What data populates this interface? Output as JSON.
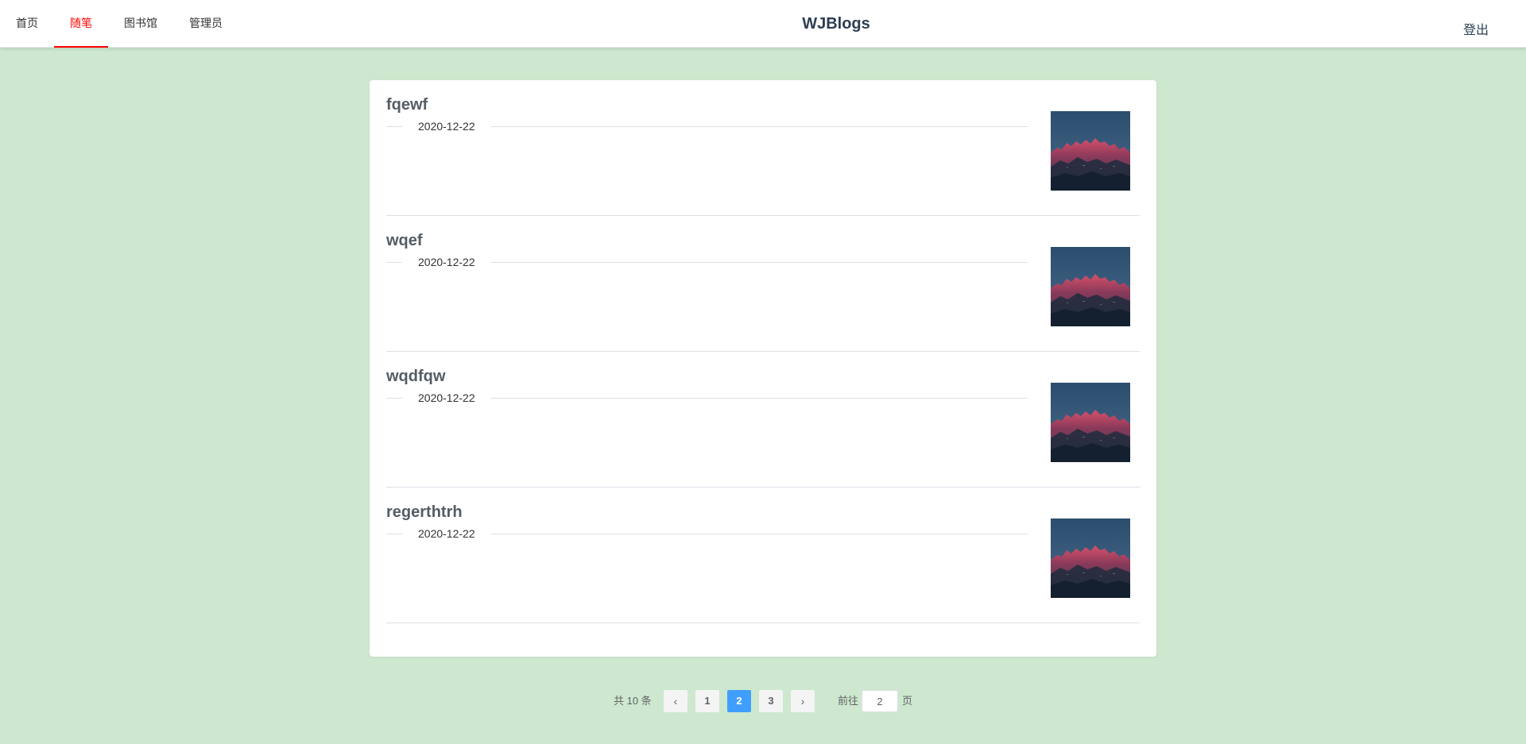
{
  "nav": {
    "items": [
      {
        "label": "首页",
        "active": false
      },
      {
        "label": "随笔",
        "active": true
      },
      {
        "label": "图书馆",
        "active": false
      },
      {
        "label": "管理员",
        "active": false
      }
    ],
    "brand": "WJBlogs",
    "logout": "登出",
    "active_color": "#ff0000"
  },
  "posts": [
    {
      "title": "fqewf",
      "date": "2020-12-22",
      "thumbnail": "mountain-sunset-image"
    },
    {
      "title": "wqef",
      "date": "2020-12-22",
      "thumbnail": "mountain-sunset-image"
    },
    {
      "title": "wqdfqw",
      "date": "2020-12-22",
      "thumbnail": "mountain-sunset-image"
    },
    {
      "title": "regerthtrh",
      "date": "2020-12-22",
      "thumbnail": "mountain-sunset-image"
    }
  ],
  "pagination": {
    "total_label": "共 10 条",
    "prev_icon": "chevron-left-icon",
    "next_icon": "chevron-right-icon",
    "pages": [
      "1",
      "2",
      "3"
    ],
    "current_page": "2",
    "goto_prefix": "前往",
    "goto_value": "2",
    "goto_suffix": "页",
    "active_color": "#409eff"
  },
  "background_color": "#cde8cf"
}
